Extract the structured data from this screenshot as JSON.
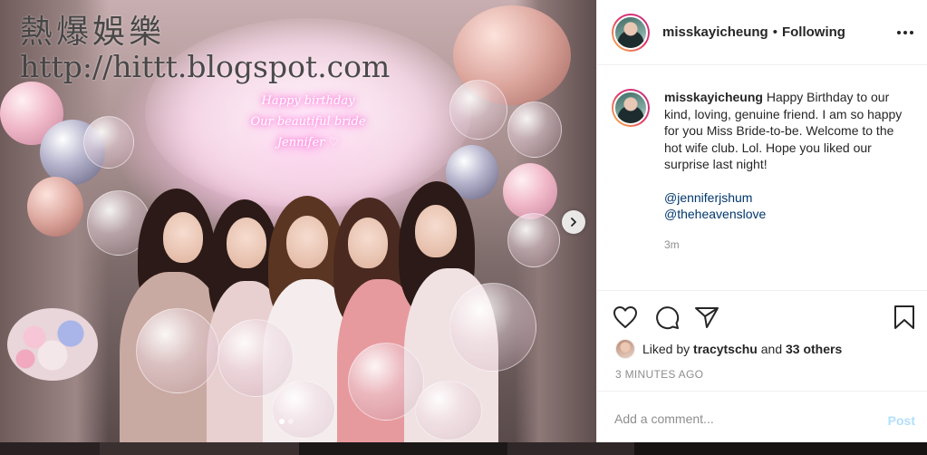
{
  "watermark": {
    "line1": "熱爆娛樂",
    "line2": "http://hittt.blogspot.com"
  },
  "photo": {
    "neon_lines": [
      "Happy birthday",
      "Our beautiful bride",
      "Jennifer ♡"
    ],
    "carousel_dots": 2,
    "active_dot": 0,
    "next_icon": "chevron-right-icon"
  },
  "header": {
    "username": "misskayicheung",
    "separator": "•",
    "follow_status": "Following",
    "more_icon": "more-horizontal-icon"
  },
  "caption": {
    "username": "misskayicheung",
    "text": "Happy Birthday to our kind, loving, genuine friend. I am so happy for you Miss Bride-to-be. Welcome to the hot wife club. Lol. Hope you liked our surprise last night!",
    "mentions": [
      "@jenniferjshum",
      "@theheavenslove"
    ],
    "time": "3m"
  },
  "actions": {
    "like_icon": "heart-icon",
    "comment_icon": "comment-icon",
    "share_icon": "paper-plane-icon",
    "save_icon": "bookmark-icon"
  },
  "likes": {
    "prefix": "Liked by",
    "user": "tracytschu",
    "connector": "and",
    "others": "33 others"
  },
  "timestamp": "3 MINUTES AGO",
  "comment": {
    "placeholder": "Add a comment...",
    "post_label": "Post",
    "post_color": "#b2dffc"
  },
  "colors": {
    "text": "#262626",
    "muted": "#8e8e8e",
    "link": "#00376b",
    "border": "#efefef"
  }
}
